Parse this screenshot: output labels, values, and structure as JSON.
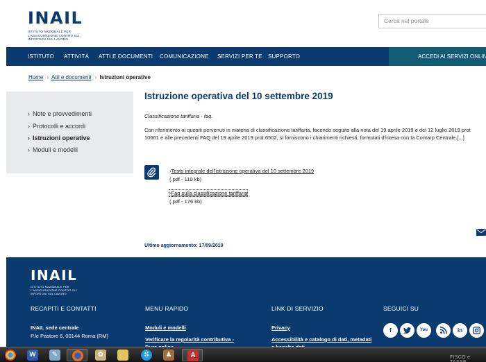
{
  "header": {
    "logo_text": "INAIL",
    "logo_subtitle": "Istituto nazionale per l'assicurazione contro gli infortuni sul lavoro",
    "search_placeholder": "Cerca nel portale"
  },
  "nav": {
    "items": [
      "ISTITUTO",
      "ATTIVITÀ",
      "ATTI E DOCUMENTI",
      "COMUNICAZIONE",
      "SERVIZI PER TE",
      "SUPPORTO"
    ],
    "login": "ACCEDI AI SERVIZI ONLINE"
  },
  "breadcrumb": {
    "items": [
      "Home",
      "Atti e documenti"
    ],
    "current": "Istruzioni operative"
  },
  "sidemenu": {
    "items": [
      "Note e provvedimenti",
      "Protocolli e accordi",
      "Istruzioni operative",
      "Moduli e modelli"
    ],
    "active_index": 2
  },
  "main": {
    "title": "Istruzione operativa del 10 settembre 2019",
    "subtitle": "Classificazione tariffaria - faq.",
    "body": "Con riferimento ai quesiti pervenuti in materia di classificazione tariffaria, facendo seguito alla nota del 19 aprile 2019 e del 12 luglio 2019 prot 10661 e alle precedenti FAQ del 19 aprile 2019 prot.6502, si forniscono i chiarimenti richiesti, formulati d'intesa con la Contarp Centrale.[...]",
    "files": [
      {
        "label": "Testo integrale dell'istruzione operativa del 10 settembre 2019",
        "size": "(.pdf - 110 kb)"
      },
      {
        "label": "Faq sulla classificazione tariffaria",
        "size": "(.pdf - 176 kb)"
      }
    ],
    "updated": "Ultimo aggiornamento: 17/09/2019"
  },
  "footer": {
    "logo_text": "INAIL",
    "logo_subtitle": "Istituto nazionale per l'assicurazione contro gli infortuni sul lavoro",
    "contacts": {
      "heading": "RECAPITI E CONTATTI",
      "line1": "INAIL sede centrale",
      "line2": "P.le Pastore 6, 00144 Roma (RM)"
    },
    "quick_menu": {
      "heading": "MENU RAPIDO",
      "link1": "Moduli e modelli",
      "link2": "Verificare la regolarità contributiva -",
      "link3": "Durc online"
    },
    "service_links": {
      "heading": "LINK DI SERVIZIO",
      "link1": "Privacy",
      "link2": "Accessibilità e catalogo di dati, metadati",
      "link3": "e banche dati"
    },
    "social": {
      "heading": "SEGUICI SU",
      "icons": [
        "facebook-icon",
        "twitter-icon",
        "youtube-icon",
        "rss-icon",
        "linkedin-icon",
        "instagram-icon"
      ]
    }
  },
  "taskbar": {
    "watermark": "FISCO e TASSE"
  },
  "colors": {
    "brand_blue": "#0b3a6e",
    "login_teal": "#135b73",
    "menu_gray": "#e8eaec"
  }
}
